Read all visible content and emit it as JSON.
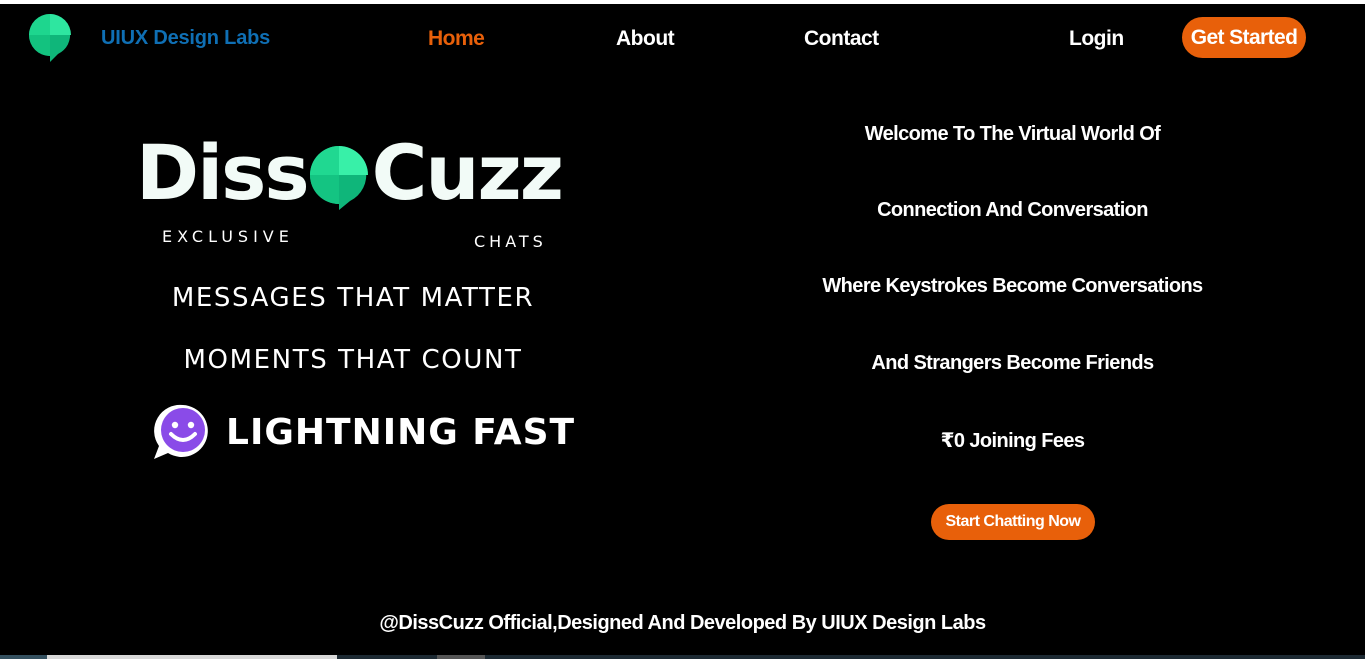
{
  "nav": {
    "brand": "UIUX Design Labs",
    "links": [
      {
        "label": "Home",
        "active": true
      },
      {
        "label": "About",
        "active": false
      },
      {
        "label": "Contact",
        "active": false
      },
      {
        "label": "Login",
        "active": false
      }
    ],
    "cta_label": "Get Started",
    "logo_icon": "green-chat-bubble-icon"
  },
  "hero_left": {
    "wordmark_left": "Diss",
    "wordmark_right": "Cuzz",
    "sub_left": "EXCLUSIVE",
    "sub_right": "CHATS",
    "tagline_1": "MESSAGES THAT MATTER",
    "tagline_2": "MOMENTS THAT COUNT",
    "feature": "LIGHTNING FAST",
    "feature_icon": "purple-smiley-chat-icon"
  },
  "hero_right": {
    "lines": [
      "Welcome To The Virtual World Of",
      "Connection And Conversation",
      "Where Keystrokes Become Conversations",
      "And Strangers Become Friends",
      "₹0 Joining Fees"
    ],
    "cta_label": "Start Chatting Now"
  },
  "footer": {
    "text": "@DissCuzz Official,Designed And Developed By UIUX Design Labs"
  },
  "colors": {
    "background": "#000000",
    "accent": "#e8600a",
    "brand_blue": "#0f6fb4",
    "logo_green": "#1ed68e"
  }
}
